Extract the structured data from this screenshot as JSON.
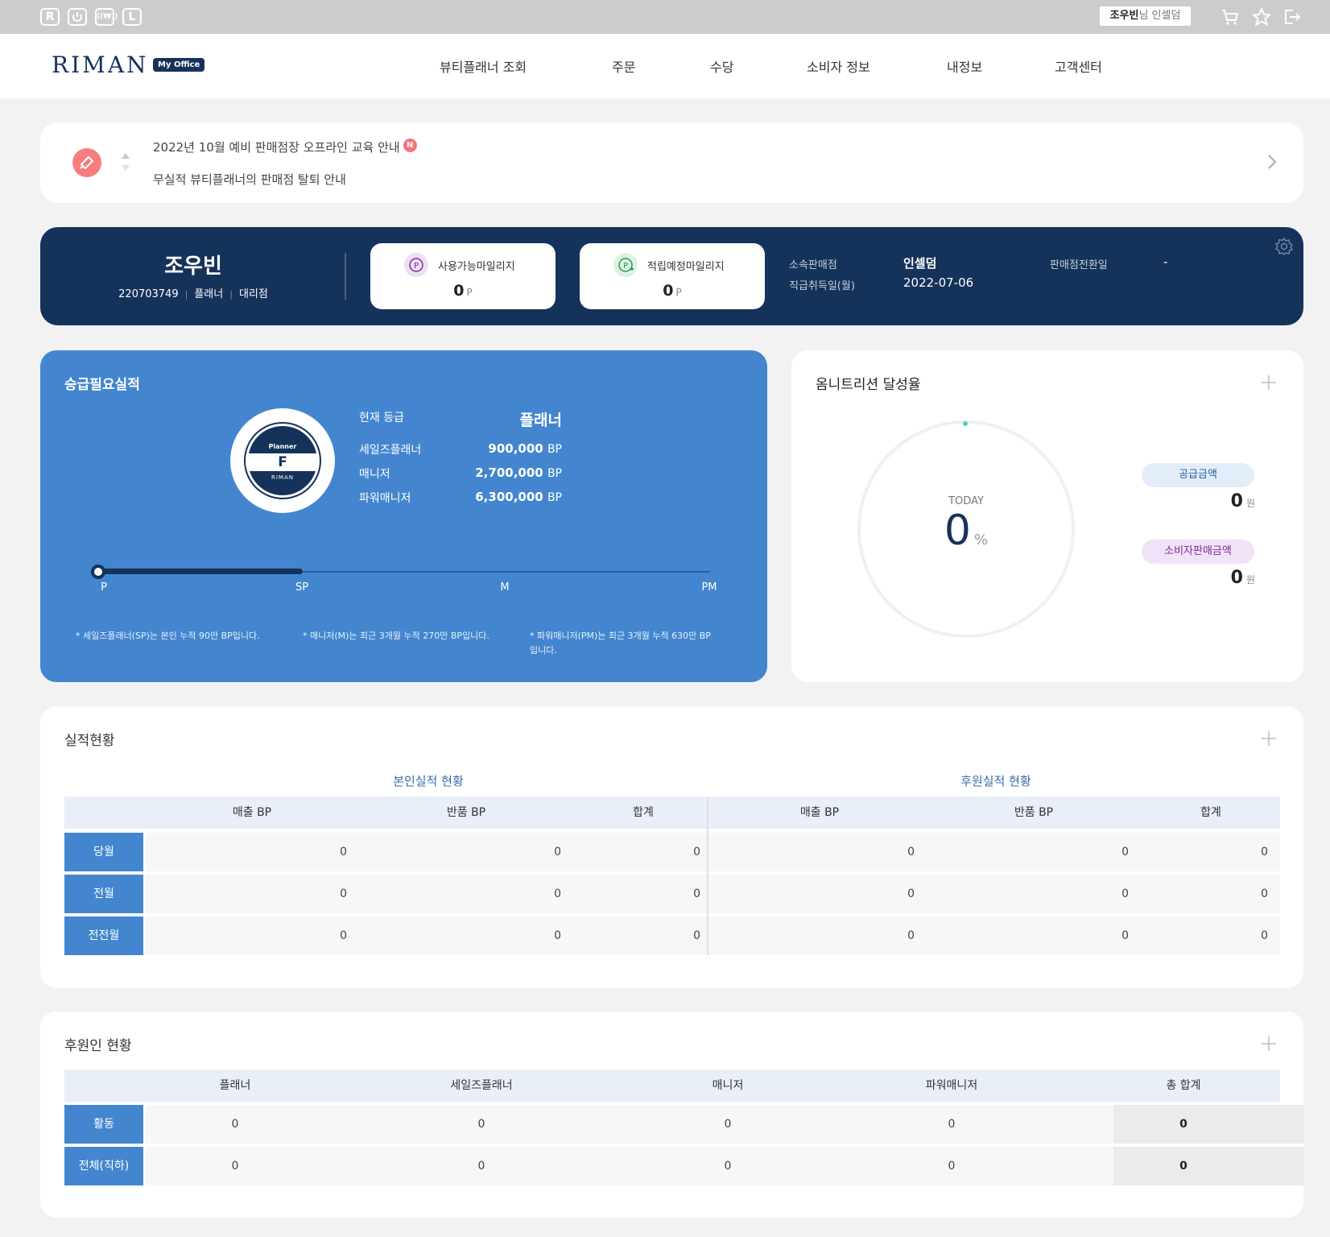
{
  "topbar": {
    "icons": [
      "R-icon",
      "power-icon",
      "rewards-icon",
      "L-icon"
    ],
    "user_name": "조우빈",
    "user_suffix": "님 인셀덤",
    "right_icons": [
      "cart-icon",
      "star-icon",
      "logout-icon"
    ]
  },
  "header": {
    "logo": "RIMAN",
    "office_badge": "My Office",
    "nav": [
      "뷰티플래너 조회",
      "주문",
      "수당",
      "소비자 정보",
      "내정보",
      "고객센터"
    ]
  },
  "notice": {
    "line1": "2022년 10월 예비 판매점장 오프라인 교육 안내",
    "new_badge": "N",
    "line2": "무실적 뷰티플래너의 판매점 탈퇴 안내"
  },
  "profile": {
    "name": "조우빈",
    "member_id": "220703749",
    "grade": "플래너",
    "type": "대리점",
    "available_mileage_label": "사용가능마일리지",
    "available_mileage_value": "0",
    "expected_mileage_label": "적립예정마일리지",
    "expected_mileage_value": "0",
    "point_unit": "P",
    "store_label": "소속판매점",
    "store_value": "인셀덤",
    "store_date_label": "판매점전환일",
    "store_date_value": "-",
    "acquired_label": "직급취득일(월)",
    "acquired_value": "2022-07-06"
  },
  "promotion": {
    "title": "승급필요실적",
    "badge_top": "Planner",
    "badge_letter": "F",
    "badge_bottom": "RIMAN",
    "current_label": "현재 등급",
    "current_value": "플래너",
    "grades": [
      {
        "label": "세일즈플래너",
        "value": "900,000",
        "unit": "BP"
      },
      {
        "label": "매니저",
        "value": "2,700,000",
        "unit": "BP"
      },
      {
        "label": "파워매니저",
        "value": "6,300,000",
        "unit": "BP"
      }
    ],
    "ticks": [
      "P",
      "SP",
      "M",
      "PM"
    ],
    "notes": [
      "* 세일즈플래너(SP)는 본인 누적 90만 BP입니다.",
      "* 매니저(M)는 최근 3개월 누적 270만 BP입니다.",
      "* 파워매니저(PM)는 최근 3개월 누적 630만 BP입니다."
    ]
  },
  "omni": {
    "title": "옴니트리션 달성율",
    "today_label": "TODAY",
    "percent": "0",
    "percent_unit": "%",
    "supply_label": "공급금액",
    "supply_value": "0",
    "consumer_label": "소비자판매금액",
    "consumer_value": "0",
    "currency": "원"
  },
  "performance": {
    "title": "실적현황",
    "group_self": "본인실적 현황",
    "group_sponsor": "후원실적 현황",
    "columns": [
      "매출 BP",
      "반품 BP",
      "합계",
      "매출 BP",
      "반품 BP",
      "합계"
    ],
    "rows": [
      {
        "label": "당월",
        "values": [
          "0",
          "0",
          "0",
          "0",
          "0",
          "0"
        ]
      },
      {
        "label": "전월",
        "values": [
          "0",
          "0",
          "0",
          "0",
          "0",
          "0"
        ]
      },
      {
        "label": "전전월",
        "values": [
          "0",
          "0",
          "0",
          "0",
          "0",
          "0"
        ]
      }
    ]
  },
  "sponsors": {
    "title": "후원인 현황",
    "columns": [
      "플래너",
      "세일즈플래너",
      "매니저",
      "파워매니저",
      "총 합계"
    ],
    "rows": [
      {
        "label": "활동",
        "values": [
          "0",
          "0",
          "0",
          "0",
          "0"
        ]
      },
      {
        "label": "전체(직하)",
        "values": [
          "0",
          "0",
          "0",
          "0",
          "0"
        ]
      }
    ]
  },
  "colors": {
    "navy": "#15325a",
    "blue": "#4386cf",
    "supply_pill_bg": "#e3edf9",
    "supply_pill_fg": "#2a5da8",
    "consumer_pill_bg": "#f1e3f7",
    "consumer_pill_fg": "#7a2a9a",
    "accent_teal": "#3fd3c7",
    "notice_red": "#f67e7e"
  }
}
